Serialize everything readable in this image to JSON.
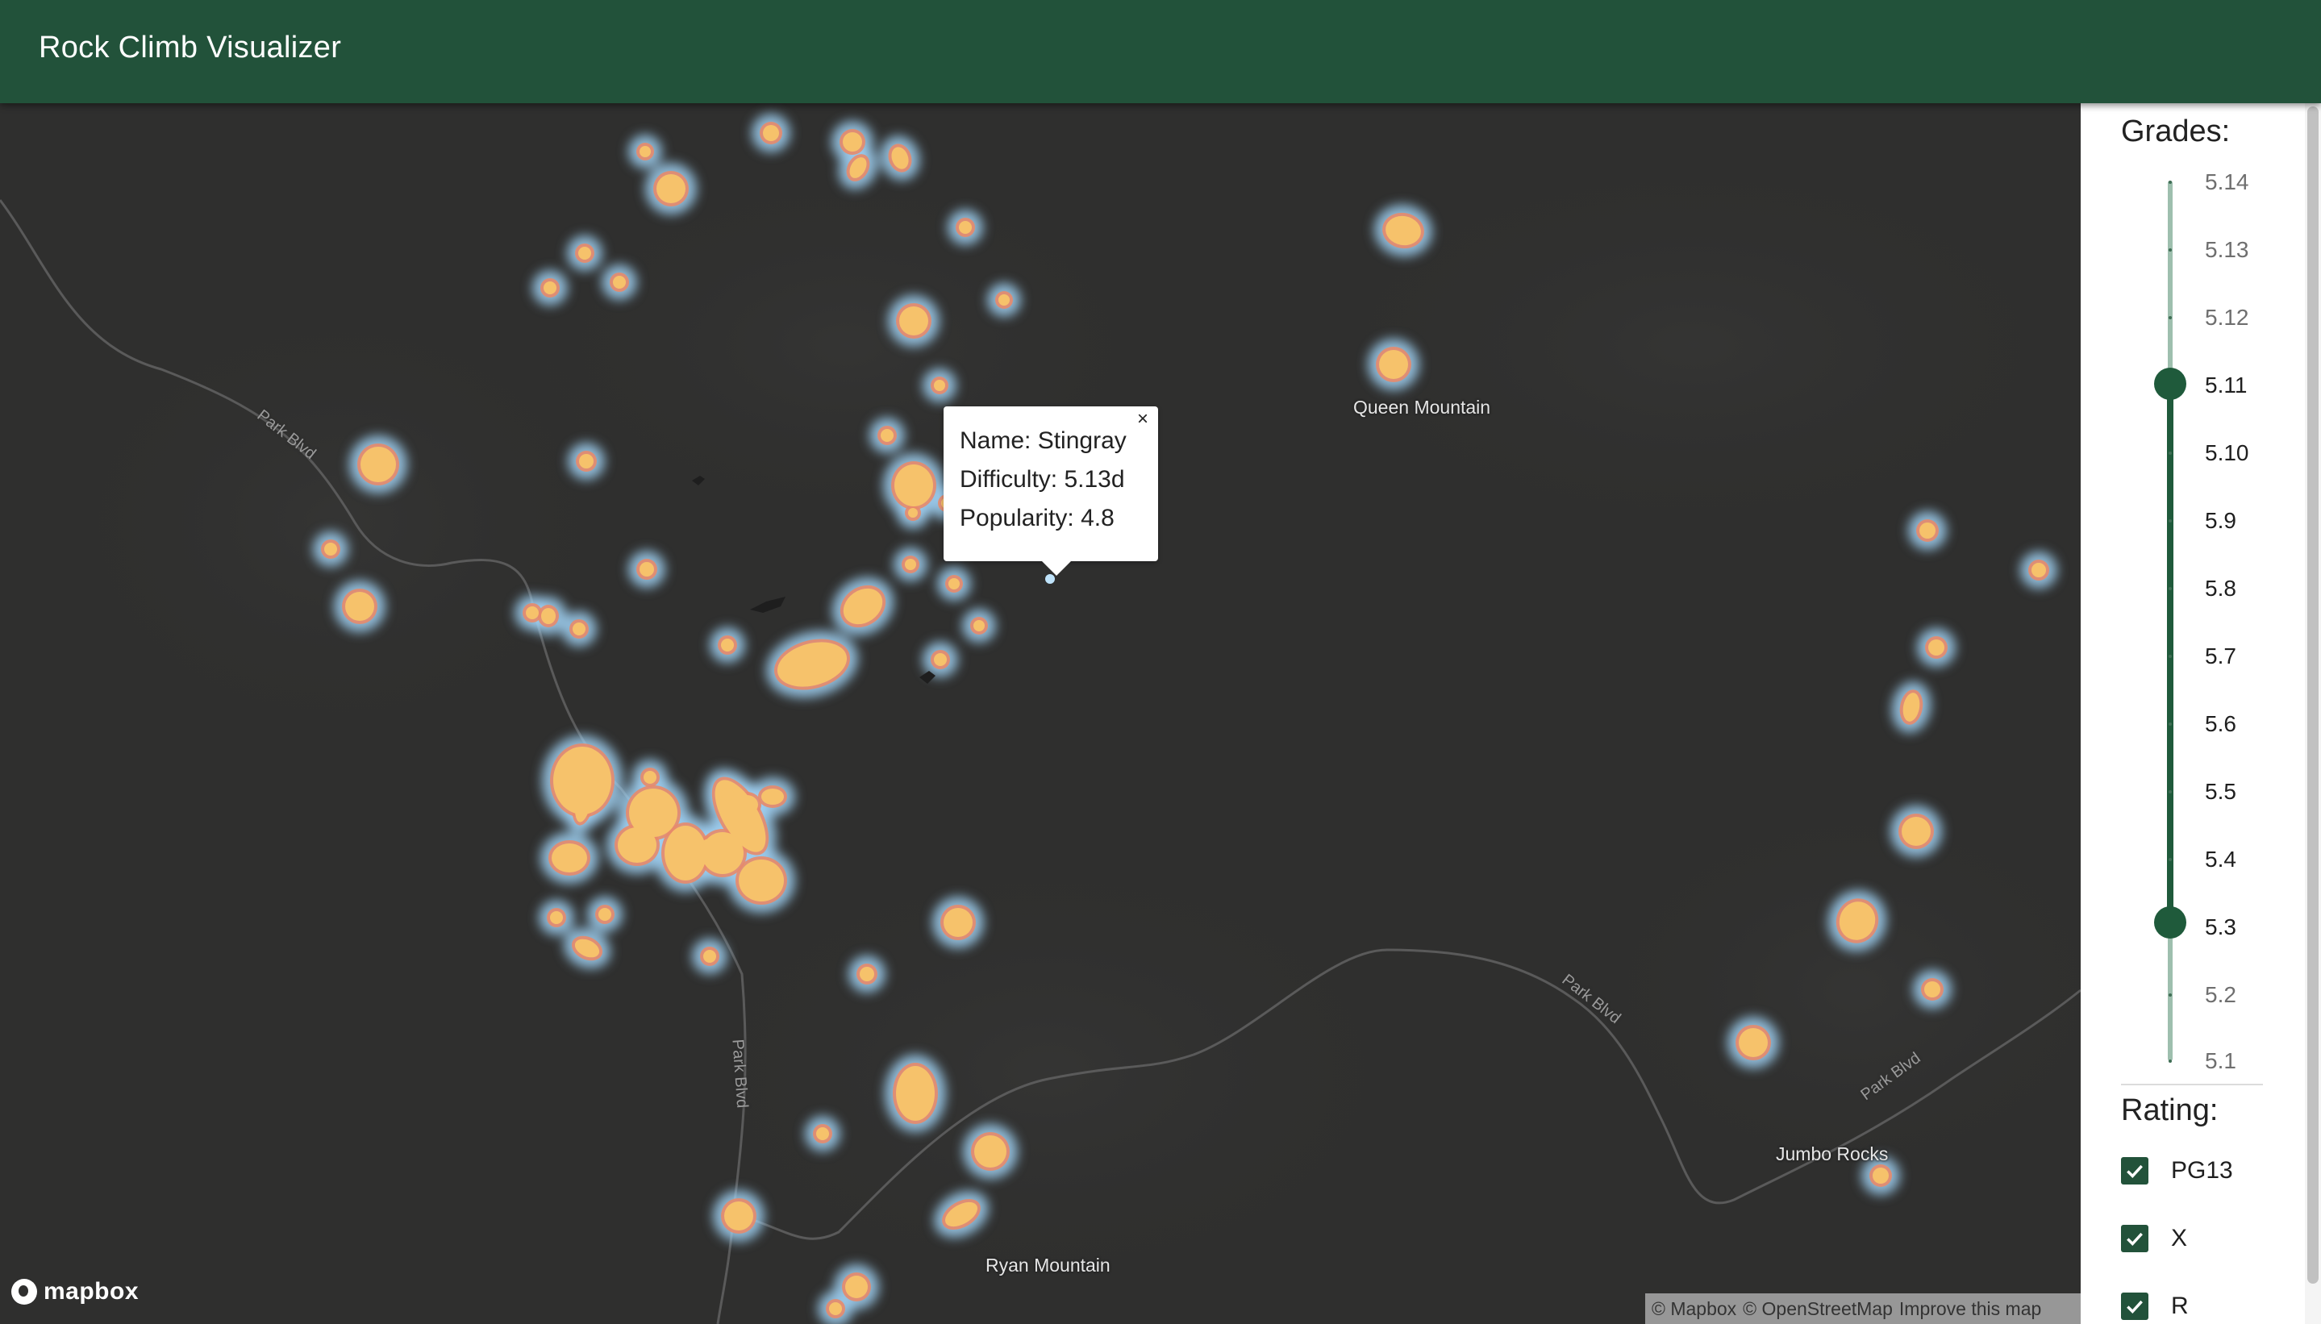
{
  "header": {
    "title": "Rock Climb Visualizer"
  },
  "map": {
    "place_labels": [
      "Queen Mountain",
      "Jumbo Rocks",
      "Ryan Mountain"
    ],
    "road_labels": [
      "Park Blvd",
      "Park Blvd",
      "Park Blvd",
      "Park Blvd"
    ],
    "logo": "mapbox",
    "attribution": [
      "© Mapbox",
      "© OpenStreetMap",
      "Improve this map"
    ],
    "popup": {
      "close": "×",
      "name_line": "Name: Stingray",
      "difficulty_line": "Difficulty: 5.13d",
      "popularity_line": "Popularity: 4.8"
    },
    "colors": {
      "background": "#2f2f2e",
      "heat_core": "#f6c26b",
      "heat_ring": "#e88a6a",
      "heat_glow": "#9fd0f2"
    }
  },
  "sidebar": {
    "grades_title": "Grades:",
    "grade_ticks": [
      "5.14",
      "5.13",
      "5.12",
      "5.11",
      "5.10",
      "5.9",
      "5.8",
      "5.7",
      "5.6",
      "5.5",
      "5.4",
      "5.3",
      "5.2",
      "5.1"
    ],
    "grade_range": {
      "min": "5.3",
      "max": "5.11"
    },
    "rating_title": "Rating:",
    "ratings": [
      {
        "label": "PG13",
        "checked": true
      },
      {
        "label": "X",
        "checked": true
      },
      {
        "label": "R",
        "checked": true
      }
    ],
    "accent_color": "#22523a"
  }
}
